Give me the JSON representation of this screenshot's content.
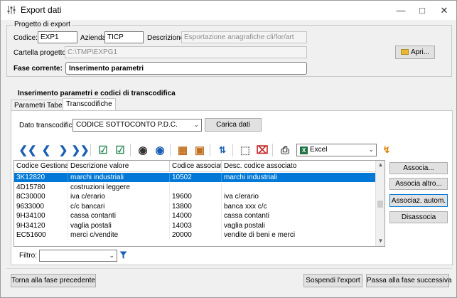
{
  "window": {
    "title": "Export dati"
  },
  "project": {
    "group_label": "Progetto di export",
    "codice_label": "Codice:",
    "codice_value": "EXP1",
    "azienda_label": "Azienda",
    "azienda_value": "TICP",
    "descrizione_label": "Descrizione:",
    "descrizione_value": "Esportazione anagrafiche cli/for/art",
    "cartella_label": "Cartella progetto:",
    "cartella_value": "C:\\TMP\\EXPG1",
    "apri_label": "Apri...",
    "fase_label": "Fase corrente:",
    "fase_value": "Inserimento parametri"
  },
  "section": {
    "title": "Inserimento parametri e codici di transcodifica"
  },
  "tabs": [
    {
      "label": "Parametri Tabelle"
    },
    {
      "label": "Transcodifiche"
    }
  ],
  "transcodifica": {
    "label": "Dato transcodifica:",
    "value": "CODICE SOTTOCONTO P.D.C.",
    "carica_label": "Carica dati"
  },
  "toolbar": {
    "export_format": "Excel"
  },
  "grid": {
    "columns": [
      "Codice Gestionale",
      "Descrizione valore",
      "Codice associato",
      "Desc. codice associato"
    ],
    "rows": [
      {
        "codice": "3K12820",
        "descrizione": "marchi industriali",
        "associato": "10502",
        "desc_associato": "marchi industriali"
      },
      {
        "codice": "4D15780",
        "descrizione": "costruzioni leggere",
        "associato": "",
        "desc_associato": ""
      },
      {
        "codice": "8C30000",
        "descrizione": "iva c/erario",
        "associato": "19600",
        "desc_associato": "iva c/erario"
      },
      {
        "codice": "9633000",
        "descrizione": "c/c bancari",
        "associato": "13800",
        "desc_associato": "banca xxx c/c"
      },
      {
        "codice": "9H34100",
        "descrizione": "cassa contanti",
        "associato": "14000",
        "desc_associato": "cassa contanti"
      },
      {
        "codice": "9H34120",
        "descrizione": "vaglia postali",
        "associato": "14003",
        "desc_associato": "vaglia postali"
      },
      {
        "codice": "EC51600",
        "descrizione": "merci c/vendite",
        "associato": "20000",
        "desc_associato": "vendite di beni e merci"
      }
    ]
  },
  "side_buttons": {
    "associa": "Associa...",
    "associa_altro": "Associa altro...",
    "associaz_autom": "Associaz. autom.",
    "disassocia": "Disassocia"
  },
  "filtro": {
    "label": "Filtro:",
    "value": ""
  },
  "footer": {
    "precedente": "Torna alla fase precedente",
    "sospendi": "Sospendi l'export",
    "successiva": "Passa alla fase successiva"
  },
  "colors": {
    "selection": "#0078d7",
    "accent_border": "#0078d7"
  }
}
